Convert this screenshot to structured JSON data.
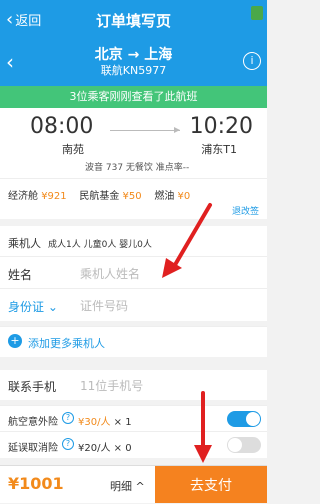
{
  "header": {
    "back_label": "返回",
    "title": "订单填写页"
  },
  "flight": {
    "route": "北京 → 上海",
    "flight_no": "联航KN5977"
  },
  "notice": "3位乘客刚刚查看了此航班",
  "times": {
    "departure": "08:00",
    "arrival": "10:20",
    "departure_airport": "南苑",
    "arrival_airport": "浦东T1",
    "meta": "波音 737  无餐饮  准点率--"
  },
  "fare": {
    "cabin_label": "经济舱",
    "cabin_price": "¥921",
    "fund_label": "民航基金",
    "fund_price": "¥50",
    "fuel_label": "燃油",
    "fuel_price": "¥0",
    "rule_link": "退改签"
  },
  "passenger": {
    "label": "乘机人",
    "counts": "成人1人  儿童0人  婴儿0人",
    "name_label": "姓名",
    "name_placeholder": "乘机人姓名",
    "id_label": "身份证",
    "id_placeholder": "证件号码",
    "add_more": "添加更多乘机人"
  },
  "contact": {
    "label": "联系手机",
    "placeholder": "11位手机号"
  },
  "insurance": [
    {
      "label": "航空意外险",
      "price": "¥30/人",
      "qty": "× 1",
      "enabled": true
    },
    {
      "label": "延误取消险",
      "price": "¥20/人",
      "qty": "× 0",
      "enabled": false
    }
  ],
  "bottom": {
    "total": "¥1001",
    "detail_label": "明细",
    "pay_label": "去支付"
  },
  "colors": {
    "primary": "#1e9be5",
    "accent": "#f5821f",
    "notice": "#43c579",
    "arrow": "#e02020"
  }
}
